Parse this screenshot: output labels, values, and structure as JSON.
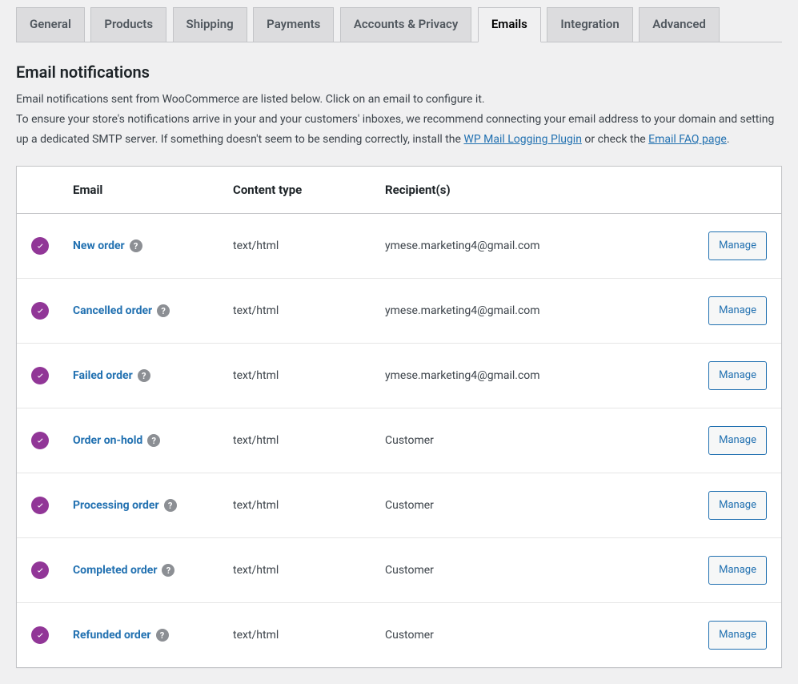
{
  "tabs": [
    {
      "label": "General",
      "active": false
    },
    {
      "label": "Products",
      "active": false
    },
    {
      "label": "Shipping",
      "active": false
    },
    {
      "label": "Payments",
      "active": false
    },
    {
      "label": "Accounts & Privacy",
      "active": false
    },
    {
      "label": "Emails",
      "active": true
    },
    {
      "label": "Integration",
      "active": false
    },
    {
      "label": "Advanced",
      "active": false
    }
  ],
  "section": {
    "title": "Email notifications",
    "description_pre": "Email notifications sent from WooCommerce are listed below. Click on an email to configure it.\nTo ensure your store's notifications arrive in your and your customers' inboxes, we recommend connecting your email address to your domain and setting up a dedicated SMTP server. If something doesn't seem to be sending correctly, install the ",
    "link1_text": "WP Mail Logging Plugin",
    "description_mid": " or check the ",
    "link2_text": "Email FAQ page",
    "description_post": "."
  },
  "table": {
    "headers": {
      "status": "",
      "name": "Email",
      "content_type": "Content type",
      "recipients": "Recipient(s)",
      "actions": ""
    },
    "rows": [
      {
        "enabled": true,
        "name": "New order",
        "content_type": "text/html",
        "recipients": "ymese.marketing4@gmail.com",
        "action": "Manage"
      },
      {
        "enabled": true,
        "name": "Cancelled order",
        "content_type": "text/html",
        "recipients": "ymese.marketing4@gmail.com",
        "action": "Manage"
      },
      {
        "enabled": true,
        "name": "Failed order",
        "content_type": "text/html",
        "recipients": "ymese.marketing4@gmail.com",
        "action": "Manage"
      },
      {
        "enabled": true,
        "name": "Order on-hold",
        "content_type": "text/html",
        "recipients": "Customer",
        "action": "Manage"
      },
      {
        "enabled": true,
        "name": "Processing order",
        "content_type": "text/html",
        "recipients": "Customer",
        "action": "Manage"
      },
      {
        "enabled": true,
        "name": "Completed order",
        "content_type": "text/html",
        "recipients": "Customer",
        "action": "Manage"
      },
      {
        "enabled": true,
        "name": "Refunded order",
        "content_type": "text/html",
        "recipients": "Customer",
        "action": "Manage"
      }
    ]
  }
}
